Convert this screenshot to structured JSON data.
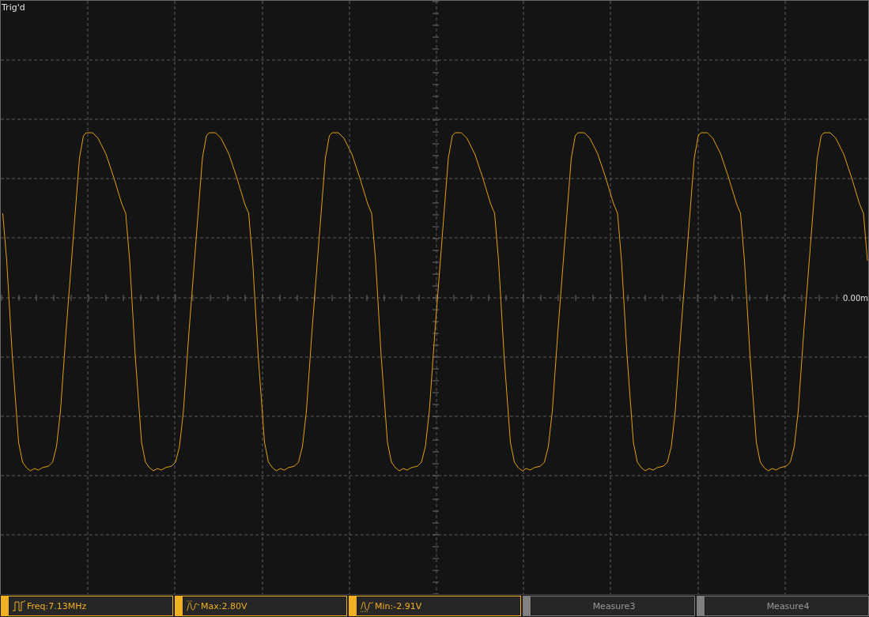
{
  "screen": {
    "status": "Trig'd",
    "offset_label": "0.00m"
  },
  "measures": [
    {
      "kind": "freq",
      "label": "Freq:7.13MHz",
      "active": true
    },
    {
      "kind": "max",
      "label": "Max:2.80V",
      "active": true
    },
    {
      "kind": "min",
      "label": "Min:-2.91V",
      "active": true
    },
    {
      "kind": "none",
      "label": "Measure3",
      "active": false
    },
    {
      "kind": "none",
      "label": "Measure4",
      "active": false
    }
  ]
}
